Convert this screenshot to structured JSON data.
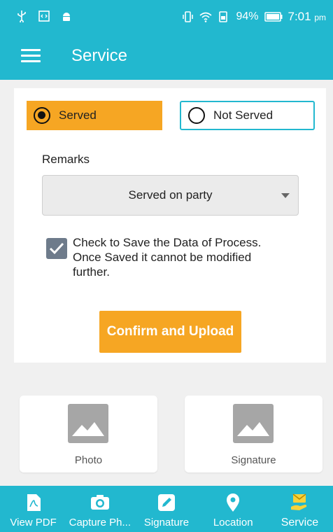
{
  "status_bar": {
    "battery": "94%",
    "time": "7:01",
    "ampm": "pm",
    "left_icons": [
      "usb-icon",
      "code-icon",
      "android-icon"
    ],
    "right_icons": [
      "vibrate-icon",
      "wifi-icon",
      "sim-icon",
      "battery-icon"
    ]
  },
  "app_bar": {
    "title": "Service",
    "menu_icon": "hamburger-menu-icon"
  },
  "service_status": {
    "options": [
      {
        "label": "Served",
        "checked": true
      },
      {
        "label": "Not Served",
        "checked": false
      }
    ]
  },
  "remarks": {
    "label": "Remarks",
    "selected": "Served on party"
  },
  "save_checkbox": {
    "checked": true,
    "text": "Check to Save the Data of Process. Once Saved it cannot be modified further."
  },
  "confirm_button": {
    "label": "Confirm and Upload"
  },
  "tiles": [
    {
      "label": "Photo",
      "icon": "image-placeholder-icon"
    },
    {
      "label": "Signature",
      "icon": "image-placeholder-icon"
    }
  ],
  "bottom_nav": {
    "items": [
      {
        "label": "View PDF",
        "icon": "pdf-icon"
      },
      {
        "label": "Capture Ph...",
        "icon": "camera-icon"
      },
      {
        "label": "Signature",
        "icon": "pencil-icon"
      },
      {
        "label": "Location",
        "icon": "location-pin-icon"
      },
      {
        "label": "Service",
        "icon": "service-hand-icon",
        "active": true
      }
    ]
  },
  "colors": {
    "primary": "#22b8cf",
    "accent": "#f6a623",
    "checkbox": "#6e7b8b"
  }
}
